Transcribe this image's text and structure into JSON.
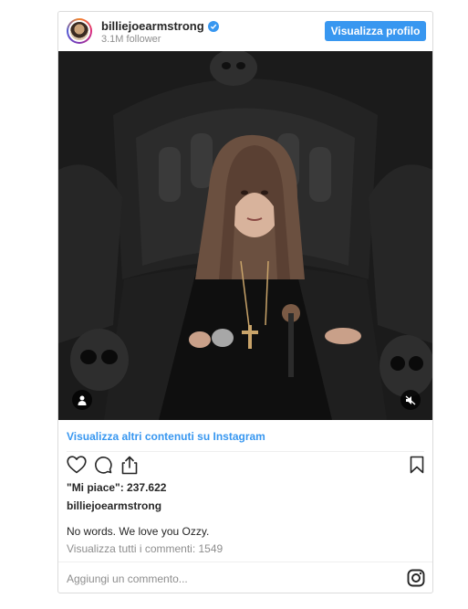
{
  "header": {
    "username": "billiejoearmstrong",
    "followers": "3.1M follower",
    "profile_button": "Visualizza profilo"
  },
  "post": {
    "more_link": "Visualizza altri contenuti su Instagram",
    "likes": "\"Mi piace\": 237.622",
    "author": "billiejoearmstrong",
    "caption": "No words. We love you Ozzy.",
    "comments_link": "Visualizza tutti i commenti: 1549",
    "comment_placeholder": "Aggiungi un commento..."
  },
  "icons": {
    "verified": "verified-badge-icon",
    "like": "heart-icon",
    "comment": "comment-icon",
    "share": "share-icon",
    "save": "bookmark-icon",
    "user_tag": "user-tag-icon",
    "mute": "mute-icon",
    "instagram": "instagram-logo-icon"
  },
  "colors": {
    "accent": "#3897f0",
    "text": "#262626",
    "muted": "#8e8e8e",
    "border": "#dbdbdb"
  }
}
